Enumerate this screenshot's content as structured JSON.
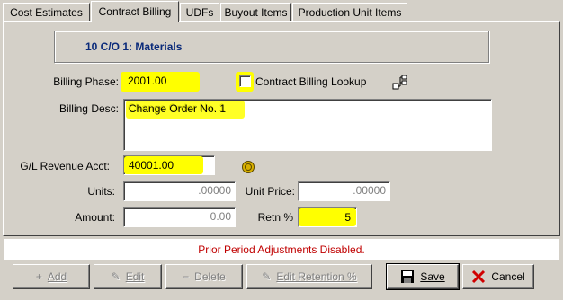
{
  "tabs": [
    {
      "label": "Cost Estimates",
      "active": false
    },
    {
      "label": "Contract Billing",
      "active": true
    },
    {
      "label": "UDFs",
      "active": false
    },
    {
      "label": "Buyout Items",
      "active": false
    },
    {
      "label": "Production Unit Items",
      "active": false
    }
  ],
  "header": {
    "title": "10  C/O 1: Materials"
  },
  "form": {
    "billing_phase_label": "Billing Phase:",
    "billing_phase_value": "2001.00",
    "contract_lookup_label": "Contract Billing Lookup",
    "contract_lookup_checked": false,
    "billing_desc_label": "Billing Desc:",
    "billing_desc_value": "Change Order No. 1",
    "gl_label": "G/L Revenue Acct:",
    "gl_value": "40001.00",
    "units_label": "Units:",
    "units_value": ".00000",
    "unit_price_label": "Unit Price:",
    "unit_price_value": ".00000",
    "amount_label": "Amount:",
    "amount_value": "0.00",
    "retn_label": "Retn %",
    "retn_value": "5"
  },
  "status": {
    "message": "Prior Period Adjustments Disabled."
  },
  "buttons": {
    "add": "Add",
    "edit": "Edit",
    "delete": "Delete",
    "edit_retention": "Edit Retention %",
    "save": "Save",
    "cancel": "Cancel"
  },
  "colors": {
    "highlight": "#ffff00",
    "status_text": "#c00000",
    "header_text": "#0a2a7a",
    "face": "#d4d0c8"
  },
  "icons": {
    "tree": "tree-hierarchy-icon",
    "gl": "gold-coin-icon",
    "save": "floppy-disk-icon",
    "cancel": "red-x-icon"
  }
}
